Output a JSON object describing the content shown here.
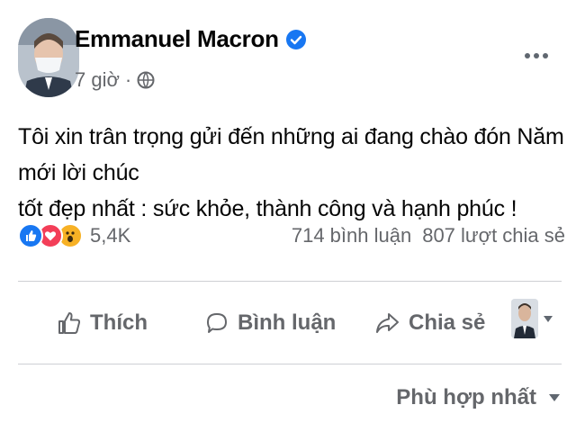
{
  "post": {
    "author": "Emmanuel Macron",
    "verified_icon": "verified-badge-icon",
    "time": "7 giờ",
    "separator": "·",
    "audience_icon": "globe-icon",
    "more_icon": "more-options-icon",
    "text_lines": [
      "Tôi xin trân trọng gửi đến những ai đang chào đón Năm mới lời chúc",
      "tốt đẹp nhất : sức khỏe, thành công và hạnh phúc !"
    ]
  },
  "stats": {
    "reaction_icons": [
      "like-reaction-icon",
      "love-reaction-icon",
      "wow-reaction-icon"
    ],
    "reaction_count": "5,4K",
    "comments": "714 bình luận",
    "shares": "807 lượt chia sẻ"
  },
  "actions": {
    "like_label": "Thích",
    "comment_label": "Bình luận",
    "share_label": "Chia sẻ"
  },
  "sort": {
    "label": "Phù hợp nhất"
  },
  "colors": {
    "accent": "#1877f2",
    "secondary_text": "#65676b",
    "like": "#1877f2",
    "love": "#f33e58",
    "wow": "#f7b125"
  }
}
